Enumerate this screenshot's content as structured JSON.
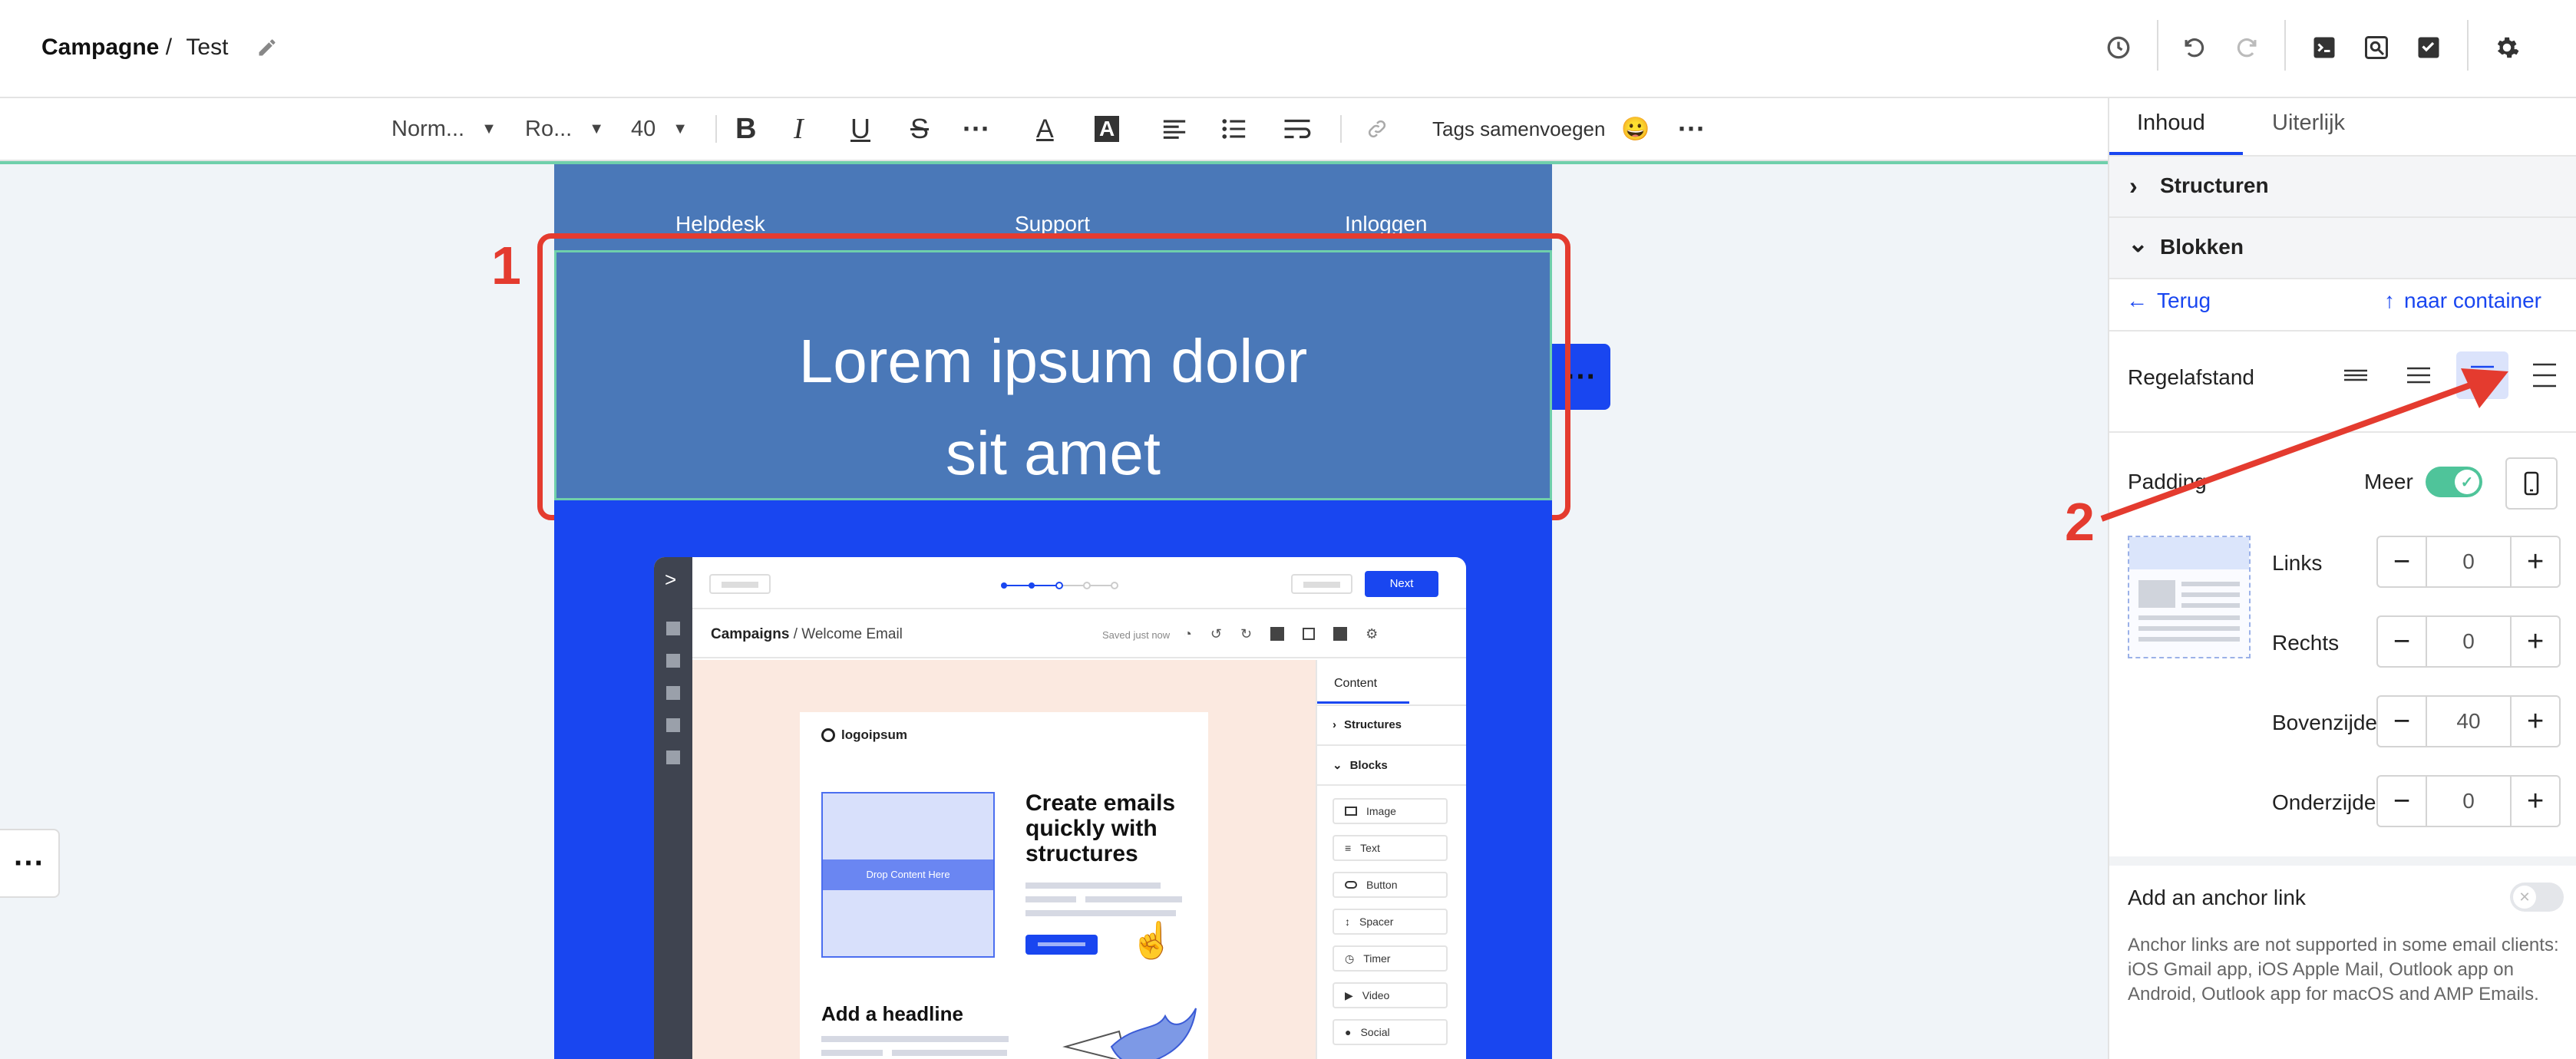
{
  "header": {
    "breadcrumb_root": "Campagne",
    "breadcrumb_sep": "/",
    "breadcrumb_current": "Test"
  },
  "toolbar": {
    "style_select": "Norm...",
    "font_select": "Ro...",
    "size_select": "40",
    "merge_tags_label": "Tags samenvoegen"
  },
  "email": {
    "nav_items": [
      "Helpdesk",
      "Support",
      "Inloggen"
    ],
    "headline_line1": "Lorem ipsum dolor",
    "headline_line2": "sit amet"
  },
  "annotations": {
    "marker1": "1",
    "marker2": "2"
  },
  "colors": {
    "accent_blue": "#1946f0",
    "header_block": "#4a78b8",
    "highlight_red": "#e43b2f",
    "toggle_green": "#4fc49a"
  },
  "mini_app": {
    "next_label": "Next",
    "breadcrumb_root": "Campaigns",
    "breadcrumb_current": "/ Welcome Email",
    "saved_text": "Saved just now",
    "logo_text": "logoipsum",
    "drop_zone": "Drop Content Here",
    "promo_title": "Create emails quickly with structures",
    "headline": "Add a headline",
    "tab_content": "Content",
    "structures": "Structures",
    "blocks": "Blocks",
    "block_items": [
      "Image",
      "Text",
      "Button",
      "Spacer",
      "Timer",
      "Video",
      "Social"
    ]
  },
  "panel": {
    "tabs": [
      {
        "label": "Inhoud",
        "active": true
      },
      {
        "label": "Uiterlijk",
        "active": false
      }
    ],
    "structures": "Structuren",
    "blocks": "Blokken",
    "back": "Terug",
    "to_container": "naar container",
    "line_spacing_label": "Regelafstand",
    "line_spacing_selected": 3,
    "padding_label": "Padding",
    "more_label": "Meer",
    "more_enabled": true,
    "paddings": [
      {
        "label": "Links",
        "value": "0"
      },
      {
        "label": "Rechts",
        "value": "0"
      },
      {
        "label": "Bovenzijde",
        "value": "40"
      },
      {
        "label": "Onderzijde",
        "value": "0"
      }
    ],
    "anchor_label": "Add an anchor link",
    "anchor_enabled": false,
    "anchor_note": "Anchor links are not supported in some email clients: iOS Gmail app, iOS Apple Mail, Outlook app on Android, Outlook app for macOS and AMP Emails."
  }
}
